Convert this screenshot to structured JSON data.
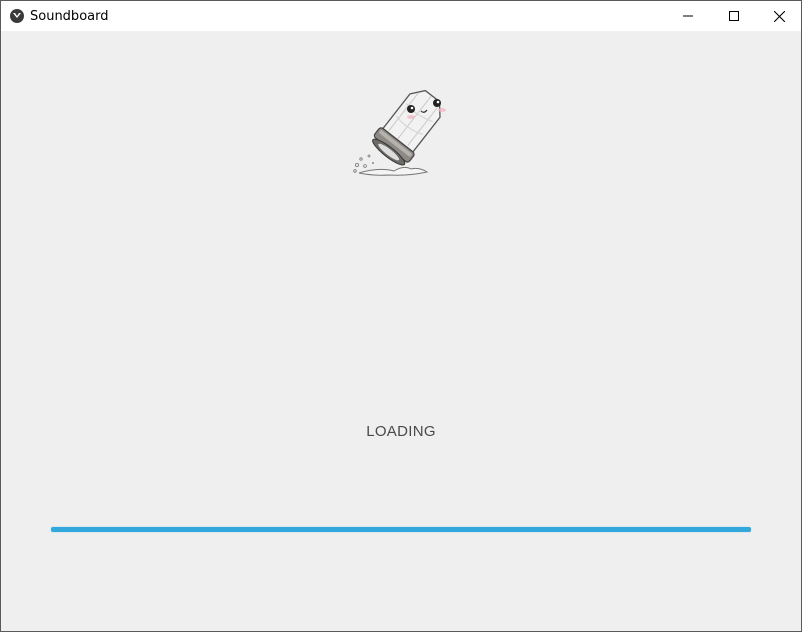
{
  "window": {
    "title": "Soundboard",
    "icon": "kivy-app-icon",
    "controls": {
      "minimize": "minimize-icon",
      "maximize": "maximize-icon",
      "close": "close-icon"
    }
  },
  "splash": {
    "logo": "salt-shaker-mascot-image",
    "status_text": "LOADING",
    "progress": 1.0,
    "progress_color": "#33a8dd"
  }
}
